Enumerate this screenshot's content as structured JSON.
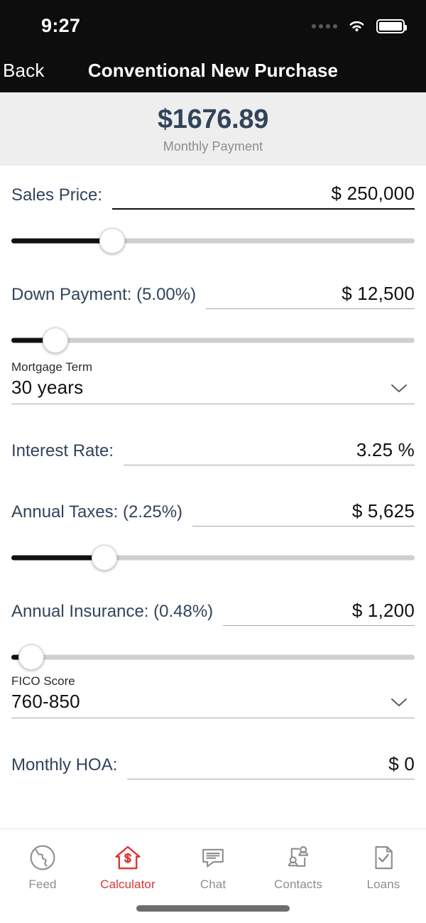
{
  "status_bar": {
    "time": "9:27",
    "signal_icon": "signal-dots-icon",
    "wifi_icon": "wifi-icon",
    "battery_icon": "battery-full-icon"
  },
  "nav": {
    "back_label": "Back",
    "title": "Conventional New Purchase"
  },
  "payment_header": {
    "amount": "$1676.89",
    "caption": "Monthly Payment",
    "amount_color": "#31445b",
    "background": "#eeeeee"
  },
  "fields": {
    "sales_price": {
      "label": "Sales Price:",
      "value": "$ 250,000",
      "slider_percent": 25
    },
    "down_payment": {
      "label": "Down Payment: (5.00%)",
      "value": "$ 12,500",
      "slider_percent": 11
    },
    "mortgage_term": {
      "caption": "Mortgage Term",
      "value": "30 years",
      "chevron_icon": "chevron-down-icon"
    },
    "interest_rate": {
      "label": "Interest Rate:",
      "value": "3.25 %"
    },
    "annual_taxes": {
      "label": "Annual Taxes: (2.25%)",
      "value": "$ 5,625",
      "slider_percent": 23
    },
    "annual_insurance": {
      "label": "Annual Insurance: (0.48%)",
      "value": "$ 1,200",
      "slider_percent": 5
    },
    "fico_score": {
      "caption": "FICO Score",
      "value": "760-850",
      "chevron_icon": "chevron-down-icon"
    },
    "monthly_hoa": {
      "label": "Monthly HOA:",
      "value": "$ 0"
    }
  },
  "tabbar": {
    "active_color": "#e03131",
    "inactive_color": "#8d8d8d",
    "items": [
      {
        "label": "Feed",
        "icon": "globe-icon",
        "active": false
      },
      {
        "label": "Calculator",
        "icon": "house-dollar-icon",
        "active": true
      },
      {
        "label": "Chat",
        "icon": "chat-bubble-icon",
        "active": false
      },
      {
        "label": "Contacts",
        "icon": "contacts-icon",
        "active": false
      },
      {
        "label": "Loans",
        "icon": "document-check-icon",
        "active": false
      }
    ]
  }
}
